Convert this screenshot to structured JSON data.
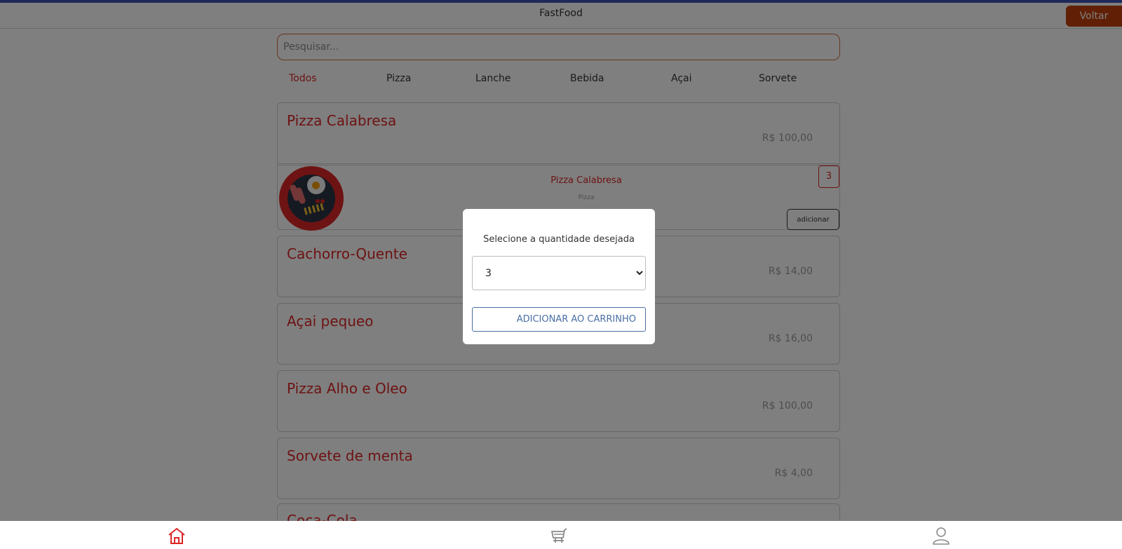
{
  "header": {
    "title": "FastFood",
    "back_label": "Voltar"
  },
  "search": {
    "placeholder": "Pesquisar...",
    "value": ""
  },
  "categories": [
    {
      "label": "Todos",
      "active": true
    },
    {
      "label": "Pizza"
    },
    {
      "label": "Lanche"
    },
    {
      "label": "Bebida"
    },
    {
      "label": "Açai"
    },
    {
      "label": "Sorvete"
    }
  ],
  "products": [
    {
      "name": "Pizza Calabresa",
      "price": "R$ 100,00"
    },
    {
      "name": "Cachorro-Quente",
      "price": "R$ 14,00"
    },
    {
      "name": "Açai pequeo",
      "price": "R$ 16,00"
    },
    {
      "name": "Pizza Alho e Oleo",
      "price": "R$ 100,00"
    },
    {
      "name": "Sorvete de menta",
      "price": "R$ 4,00"
    },
    {
      "name": "Coca-Cola"
    }
  ],
  "expanded": {
    "name": "Pizza Calabresa",
    "category": "Pizza",
    "quantity": "3",
    "add_label": "adicionar"
  },
  "modal": {
    "title": "Selecione a quantidade desejada",
    "selected_quantity": "3",
    "add_to_cart_label": "ADICIONAR AO CARRINHO"
  },
  "bottom_nav": {
    "icons": [
      "home-icon",
      "cart-icon",
      "user-icon"
    ]
  },
  "colors": {
    "accent": "#dc2626",
    "back_button": "#c2410c",
    "modal_button": "#4a6fa5"
  }
}
